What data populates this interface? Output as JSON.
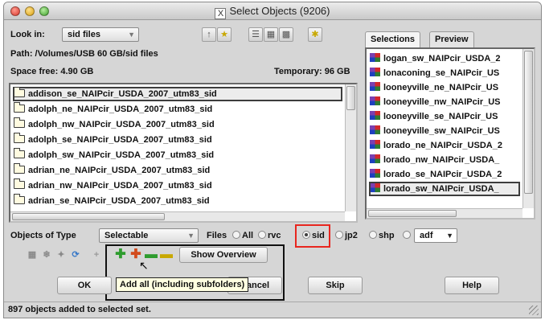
{
  "window": {
    "title": "Select Objects (9206)"
  },
  "browser": {
    "look_in_label": "Look in:",
    "look_in_value": "sid files",
    "path_text": "Path: /Volumes/USB 60 GB/sid files",
    "space_free": "Space free: 4.90 GB",
    "temporary": "Temporary: 96 GB",
    "files": [
      "addison_se_NAIPcir_USDA_2007_utm83_sid",
      "adolph_ne_NAIPcir_USDA_2007_utm83_sid",
      "adolph_nw_NAIPcir_USDA_2007_utm83_sid",
      "adolph_se_NAIPcir_USDA_2007_utm83_sid",
      "adolph_sw_NAIPcir_USDA_2007_utm83_sid",
      "adrian_ne_NAIPcir_USDA_2007_utm83_sid",
      "adrian_nw_NAIPcir_USDA_2007_utm83_sid",
      "adrian_se_NAIPcir_USDA_2007_utm83_sid"
    ]
  },
  "tabs": {
    "selections": "Selections",
    "preview": "Preview"
  },
  "selections": [
    "logan_sw_NAIPcir_USDA_2",
    "lonaconing_se_NAIPcir_US",
    "looneyville_ne_NAIPcir_US",
    "looneyville_nw_NAIPcir_US",
    "looneyville_se_NAIPcir_US",
    "looneyville_sw_NAIPcir_US",
    "lorado_ne_NAIPcir_USDA_2",
    "lorado_nw_NAIPcir_USDA_",
    "lorado_se_NAIPcir_USDA_2",
    "lorado_sw_NAIPcir_USDA_"
  ],
  "filter": {
    "objects_of_type_label": "Objects of Type",
    "objects_of_type_value": "Selectable",
    "files_label": "Files",
    "options": [
      "All",
      "rvc",
      "sid",
      "jp2",
      "shp"
    ],
    "selected_option": "sid",
    "extra_combo_value": "adf"
  },
  "toolbar": {
    "show_overview": "Show Overview",
    "tooltip": "Add all (including subfolders)"
  },
  "buttons": {
    "ok": "OK",
    "cancel": "Cancel",
    "skip": "Skip",
    "help": "Help"
  },
  "status": {
    "text": "897 objects added to selected set."
  },
  "colors": {
    "highlight_red": "#e8261f",
    "window_bg": "#d6d6d6"
  }
}
